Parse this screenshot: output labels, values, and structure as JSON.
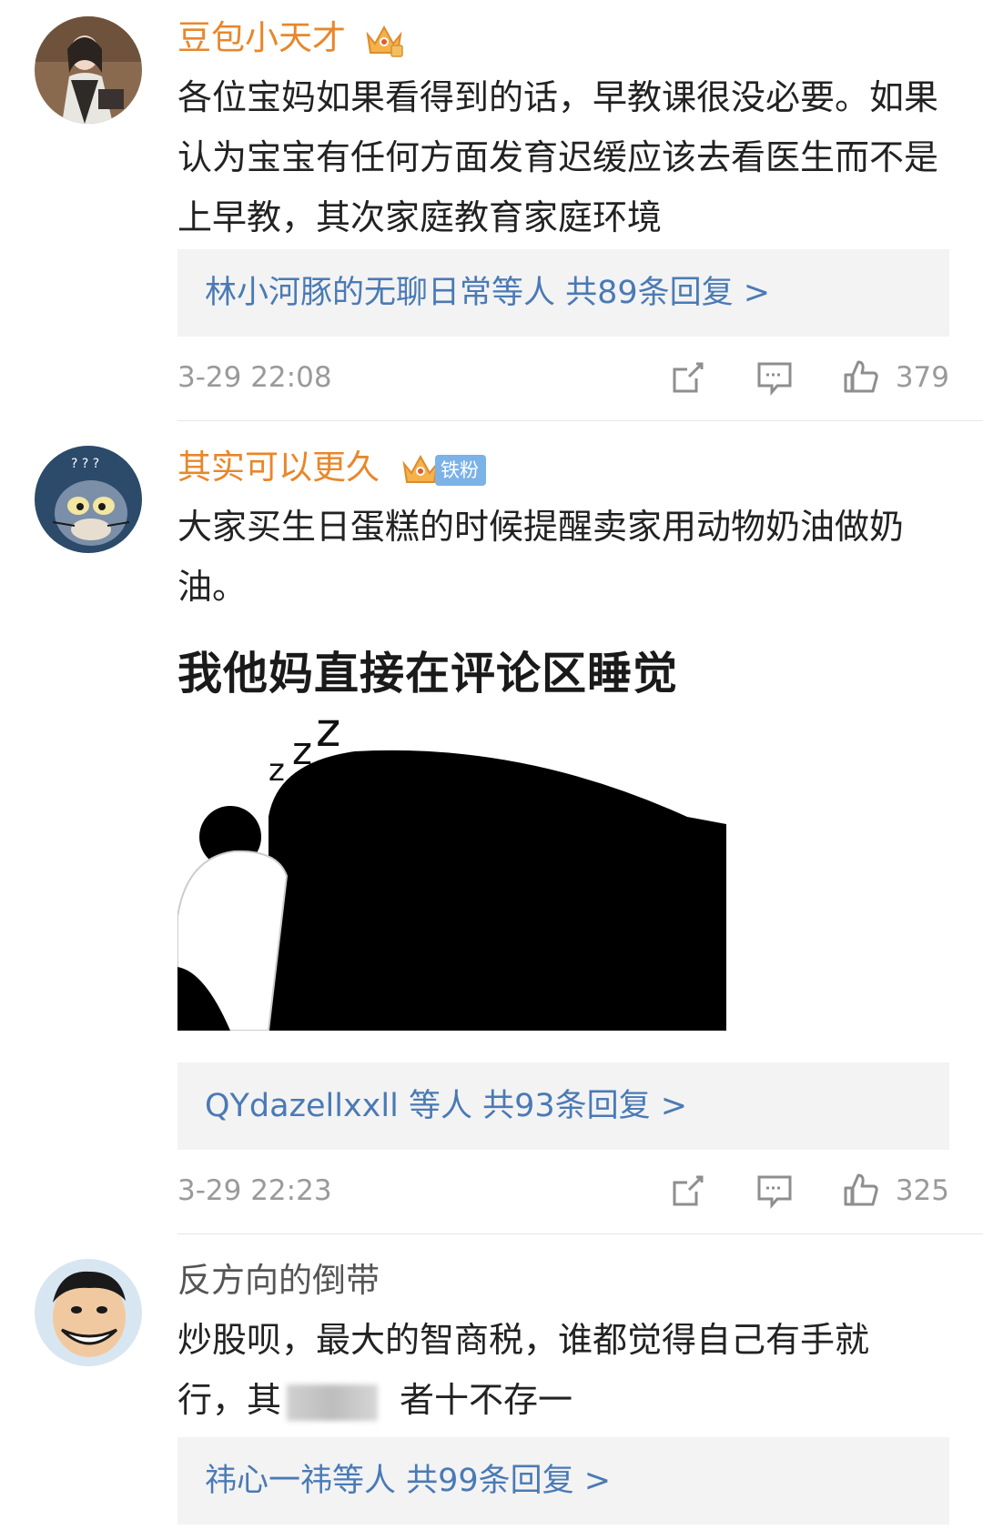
{
  "comments": [
    {
      "username": "豆包小天才",
      "content": "各位宝妈如果看得到的话，早教课很没必要。如果认为宝宝有任何方面发育迟缓应该去看医生而不是上早教，其次家庭教育家庭环境",
      "reply_summary": "林小河豚的无聊日常等人 共89条回复 >",
      "time": "3-29 22:08",
      "likes": "379"
    },
    {
      "username": "其实可以更久",
      "fan_tag": "铁粉",
      "content": "大家买生日蛋糕的时候提醒卖家用动物奶油做奶油。",
      "meme_caption": "我他妈直接在评论区睡觉",
      "reply_summary": "QYdazellxxll 等人 共93条回复 >",
      "time": "3-29 22:23",
      "likes": "325"
    },
    {
      "username": "反方向的倒带",
      "content_line1": "炒股呗，最大的智商税，谁都觉得自己有手就",
      "content_line2_start": "行，其",
      "content_line2_end": "者十不存一",
      "reply_summary": "祎心一祎等人 共99条回复 >"
    }
  ],
  "colors": {
    "vip_name": "#e8872b",
    "reply_link": "#4a7ab5",
    "meta_gray": "#9a9a9a",
    "reply_bg": "#f3f3f3",
    "fan_tag_bg": "#7bb2e8"
  },
  "icons": [
    "crown-icon",
    "share-icon",
    "comment-icon",
    "like-icon"
  ]
}
